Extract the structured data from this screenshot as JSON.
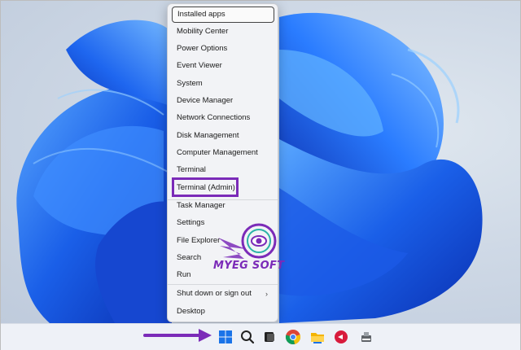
{
  "start_menu": {
    "items": [
      {
        "label": "Installed apps",
        "selected": true
      },
      {
        "label": "Mobility Center"
      },
      {
        "label": "Power Options"
      },
      {
        "label": "Event Viewer"
      },
      {
        "label": "System"
      },
      {
        "label": "Device Manager"
      },
      {
        "label": "Network Connections"
      },
      {
        "label": "Disk Management"
      },
      {
        "label": "Computer Management"
      },
      {
        "label": "Terminal"
      },
      {
        "label": "Terminal (Admin)",
        "highlighted": true
      },
      {
        "label": "Task Manager"
      },
      {
        "label": "Settings"
      },
      {
        "label": "File Explorer"
      },
      {
        "label": "Search"
      },
      {
        "label": "Run"
      },
      {
        "label": "Shut down or sign out",
        "submenu": true
      },
      {
        "label": "Desktop"
      }
    ],
    "submenu_glyph": "›"
  },
  "watermark": {
    "text": "MYEG SOFT",
    "color": "#7b2bb8"
  },
  "highlight_color": "#7b2bb8",
  "taskbar": {
    "icons": [
      "windows-start-icon",
      "search-icon",
      "task-view-icon",
      "chrome-icon",
      "file-explorer-icon",
      "app-icon",
      "device-icon"
    ]
  }
}
